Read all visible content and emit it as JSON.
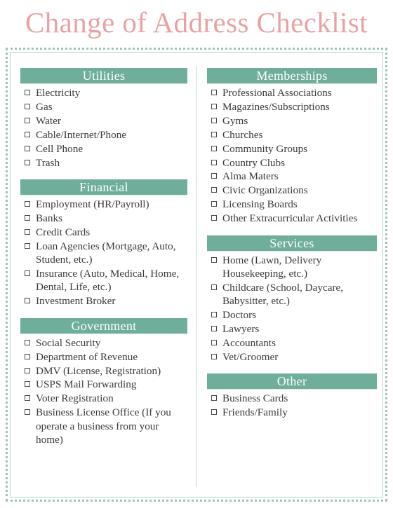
{
  "document": {
    "title": "Change of Address Checklist",
    "title_color": "#e9a2a2",
    "header_bar_color": "#6fae9b",
    "header_text_color": "#ffffff",
    "frame_color": "#9cc3bd",
    "body_text_color": "#3a3a3a",
    "checkbox_icon": "empty-checkbox"
  },
  "columns": {
    "left": [
      {
        "heading": "Utilities",
        "items": [
          "Electricity",
          "Gas",
          "Water",
          "Cable/Internet/Phone",
          "Cell Phone",
          "Trash"
        ]
      },
      {
        "heading": "Financial",
        "items": [
          "Employment (HR/Payroll)",
          "Banks",
          "Credit Cards",
          "Loan Agencies (Mortgage, Auto, Student, etc.)",
          "Insurance (Auto, Medical, Home, Dental, Life, etc.)",
          "Investment Broker"
        ]
      },
      {
        "heading": "Government",
        "items": [
          "Social Security",
          "Department of Revenue",
          "DMV (License, Registration)",
          "USPS Mail Forwarding",
          "Voter Registration",
          "Business License Office (If you operate a business from your home)"
        ]
      }
    ],
    "right": [
      {
        "heading": "Memberships",
        "items": [
          "Professional Associations",
          "Magazines/Subscriptions",
          "Gyms",
          "Churches",
          "Community Groups",
          "Country Clubs",
          "Alma Maters",
          "Civic Organizations",
          "Licensing Boards",
          "Other Extracurricular Activities"
        ]
      },
      {
        "heading": "Services",
        "items": [
          "Home (Lawn, Delivery Housekeeping, etc.)",
          "Childcare (School, Daycare, Babysitter, etc.)",
          "Doctors",
          "Lawyers",
          "Accountants",
          "Vet/Groomer"
        ]
      },
      {
        "heading": "Other",
        "items": [
          "Business Cards",
          "Friends/Family"
        ]
      }
    ]
  }
}
